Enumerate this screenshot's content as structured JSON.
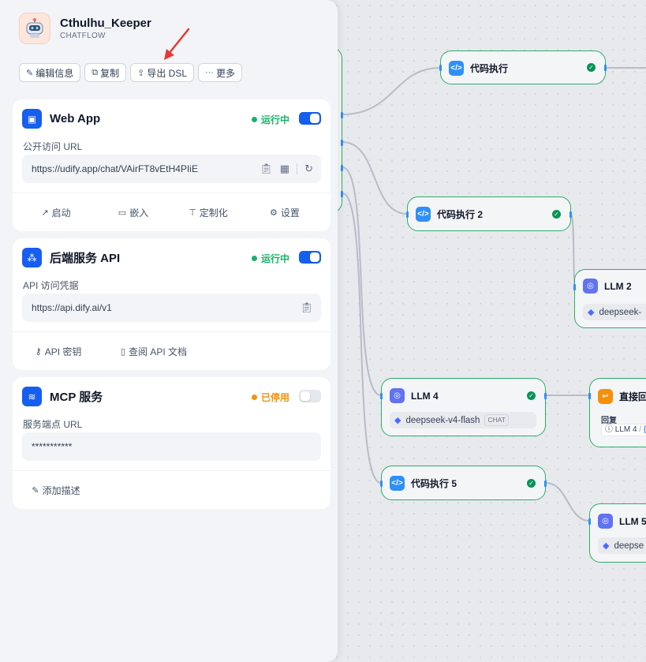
{
  "app": {
    "name": "Cthulhu_Keeper",
    "type": "CHATFLOW",
    "actions": [
      {
        "label": "编辑信息",
        "icon": "edit-icon"
      },
      {
        "label": "复制",
        "icon": "copy-icon"
      },
      {
        "label": "导出 DSL",
        "icon": "export-icon"
      },
      {
        "label": "更多",
        "icon": "more-icon"
      }
    ]
  },
  "webapp": {
    "title": "Web App",
    "status": "运行中",
    "status_color": "#17b26a",
    "enabled": true,
    "url_label": "公开访问 URL",
    "url": "https://udify.app/chat/VAirFT8vEtH4PIiE",
    "links": [
      {
        "label": "启动",
        "icon": "launch-icon"
      },
      {
        "label": "嵌入",
        "icon": "embed-icon"
      },
      {
        "label": "定制化",
        "icon": "paint-icon"
      },
      {
        "label": "设置",
        "icon": "settings-icon"
      }
    ]
  },
  "api": {
    "title": "后端服务 API",
    "status": "运行中",
    "status_color": "#17b26a",
    "enabled": true,
    "label": "API 访问凭据",
    "url": "https://api.dify.ai/v1",
    "links": [
      {
        "label": "API 密钥",
        "icon": "key-icon"
      },
      {
        "label": "查阅 API 文档",
        "icon": "book-icon"
      }
    ]
  },
  "mcp": {
    "title": "MCP 服务",
    "status": "已停用",
    "status_color": "#f79009",
    "enabled": false,
    "label": "服务端点 URL",
    "url": "***********",
    "add_desc": "添加描述"
  },
  "canvas": {
    "nodes": {
      "code1": {
        "title": "代码执行"
      },
      "code2": {
        "title": "代码执行 2"
      },
      "code5": {
        "title": "代码执行 5"
      },
      "llm2": {
        "title": "LLM 2",
        "model": "deepseek-"
      },
      "llm4": {
        "title": "LLM 4",
        "model": "deepseek-v4-flash",
        "tag": "CHAT"
      },
      "llm5": {
        "title": "LLM 5",
        "model": "deepse"
      },
      "answer": {
        "title": "直接回",
        "reply_label": "回复",
        "ref": "LLM 4",
        "ref_sep": "/",
        "ref_more": "{"
      }
    }
  },
  "colors": {
    "accent": "#155eef",
    "node_border": "#2bae6b",
    "arrow": "#e53935"
  }
}
